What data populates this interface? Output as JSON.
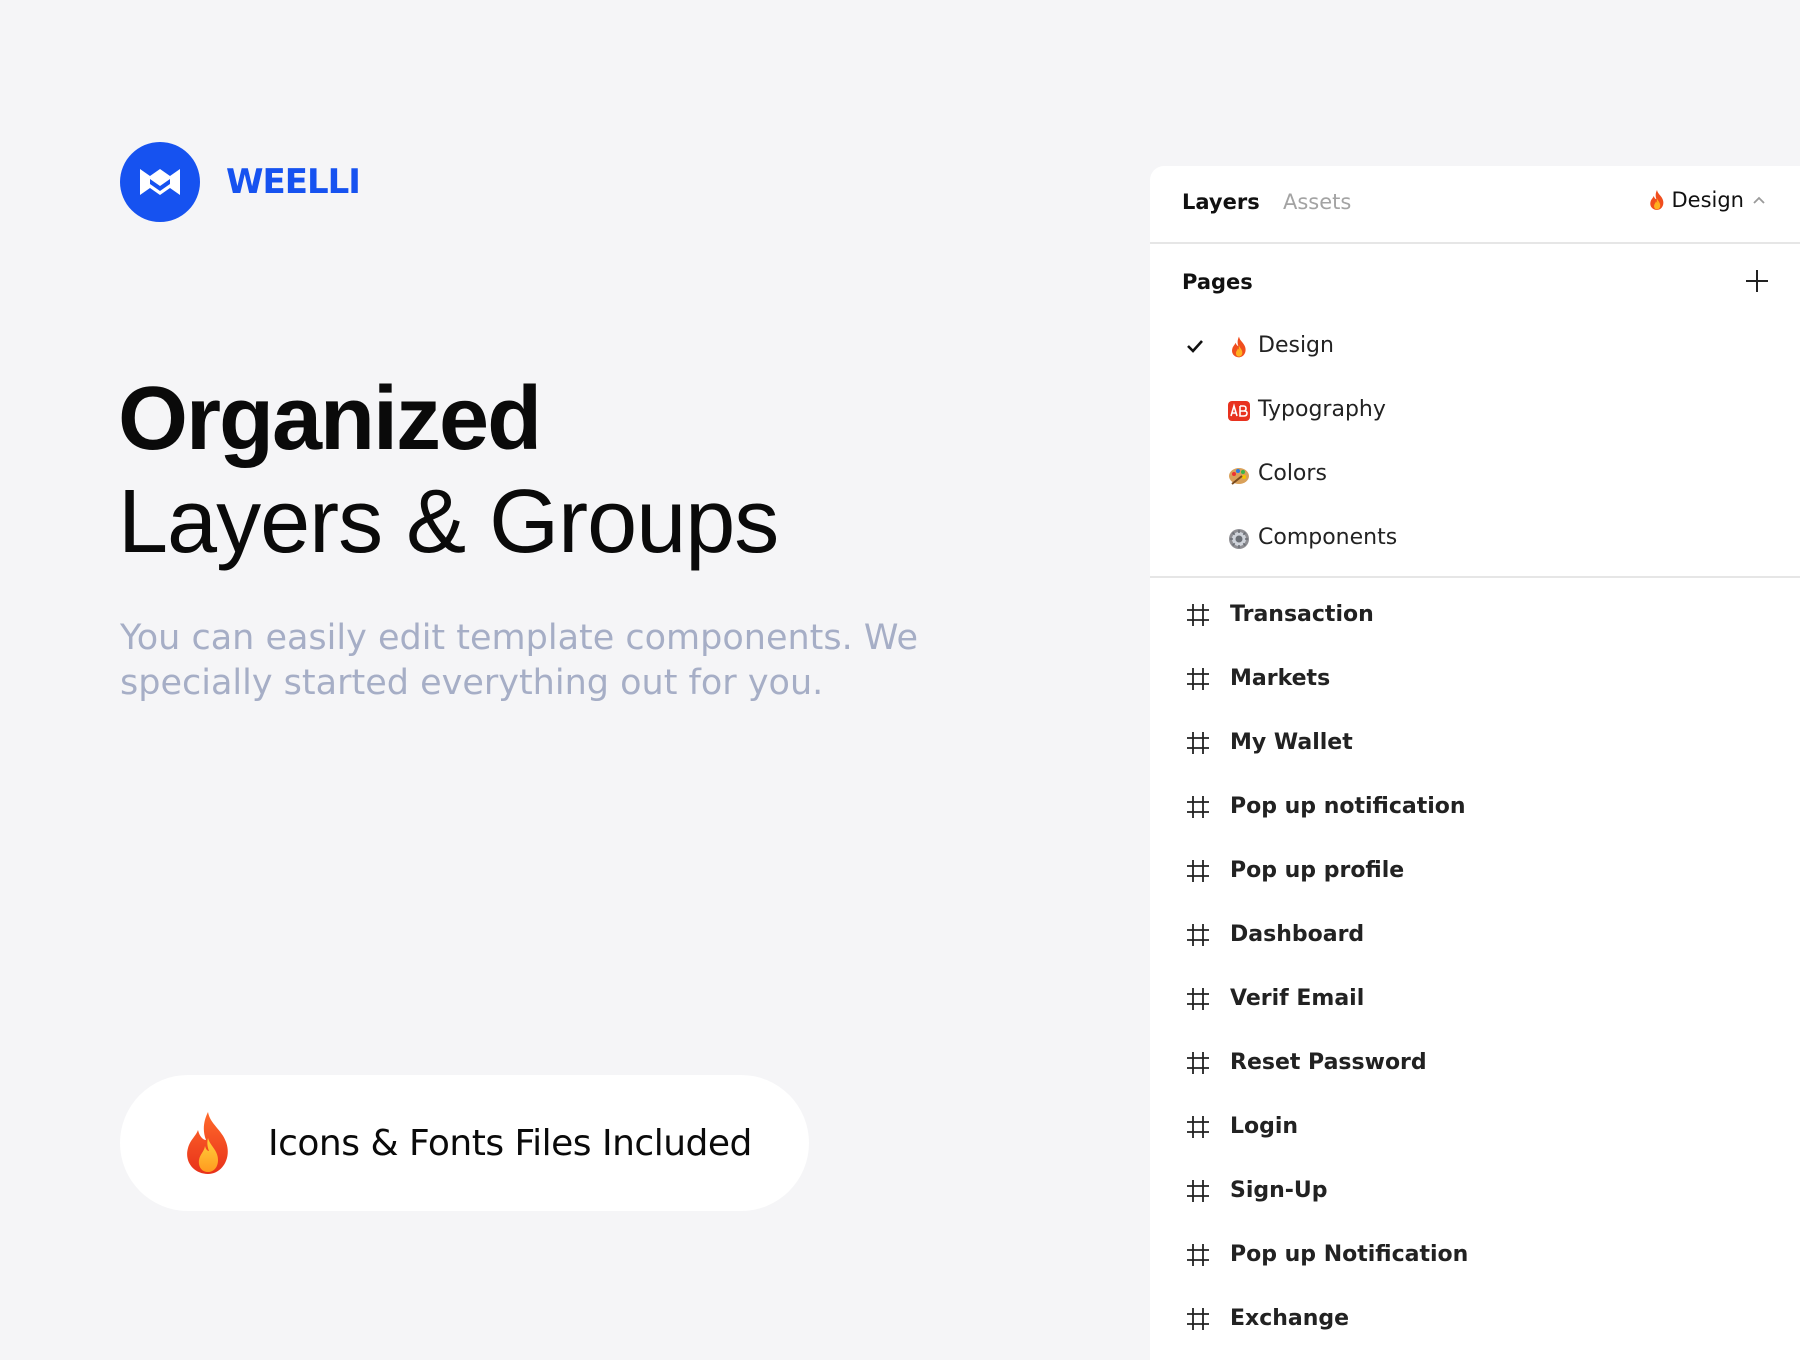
{
  "brand": {
    "name": "WEELLI",
    "accent_color": "#1652f0"
  },
  "hero": {
    "title_strong": "Organized",
    "title_light": "Layers & Groups",
    "subtitle": "You can easily edit template components. We specially started everything out for you."
  },
  "feature_pill": {
    "icon": "fire-icon",
    "label": "Icons & Fonts Files Included"
  },
  "panel": {
    "tabs": [
      {
        "label": "Layers",
        "active": true
      },
      {
        "label": "Assets",
        "active": false
      }
    ],
    "current_page": {
      "icon": "fire-icon",
      "label": "Design"
    },
    "pages_title": "Pages",
    "pages": [
      {
        "icon": "fire-icon",
        "label": "Design",
        "selected": true
      },
      {
        "icon": "ab-badge-icon",
        "label": "Typography",
        "selected": false
      },
      {
        "icon": "palette-icon",
        "label": "Colors",
        "selected": false
      },
      {
        "icon": "gear-icon",
        "label": "Components",
        "selected": false
      }
    ],
    "frames": [
      {
        "icon": "frame-hash-icon",
        "label": "Transaction"
      },
      {
        "icon": "frame-hash-icon",
        "label": "Markets"
      },
      {
        "icon": "frame-hash-icon",
        "label": "My Wallet"
      },
      {
        "icon": "frame-hash-icon",
        "label": "Pop up notification"
      },
      {
        "icon": "frame-hash-icon",
        "label": "Pop up profile"
      },
      {
        "icon": "frame-hash-icon",
        "label": "Dashboard"
      },
      {
        "icon": "frame-hash-icon",
        "label": "Verif Email"
      },
      {
        "icon": "frame-hash-icon",
        "label": "Reset Password"
      },
      {
        "icon": "frame-hash-icon",
        "label": "Login"
      },
      {
        "icon": "frame-hash-icon",
        "label": "Sign-Up"
      },
      {
        "icon": "frame-hash-icon",
        "label": "Pop up Notification"
      },
      {
        "icon": "frame-hash-icon",
        "label": "Exchange"
      }
    ]
  }
}
